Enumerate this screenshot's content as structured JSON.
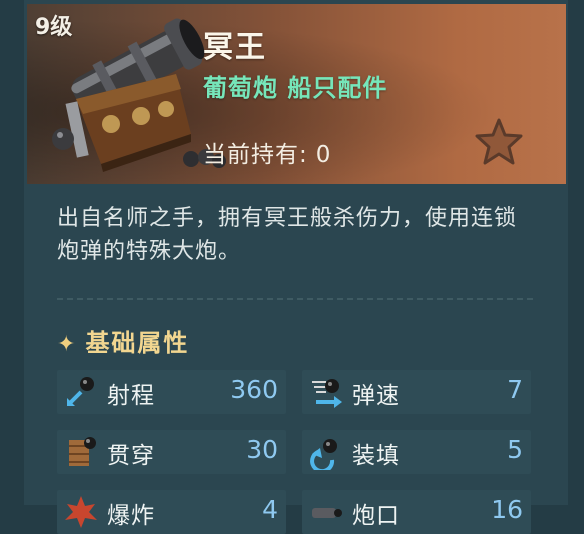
{
  "item": {
    "level": "9级",
    "name": "冥王",
    "subtitle": "葡萄炮 船只配件",
    "owned_label": "当前持有:",
    "owned_value": "0",
    "description": "出自名师之手，拥有冥王般杀伤力，使用连锁炮弹的特殊大炮。"
  },
  "stats_section": {
    "title": "基础属性",
    "stats": [
      {
        "label": "射程",
        "value": "360",
        "icon": "range-icon"
      },
      {
        "label": "弹速",
        "value": "7",
        "icon": "bullet-speed-icon"
      },
      {
        "label": "贯穿",
        "value": "30",
        "icon": "penetration-icon"
      },
      {
        "label": "装填",
        "value": "5",
        "icon": "reload-icon"
      },
      {
        "label": "爆炸",
        "value": "4",
        "icon": "explosion-icon"
      },
      {
        "label": "炮口",
        "value": "16",
        "icon": "muzzle-icon"
      }
    ]
  },
  "colors": {
    "accent_green": "#76e6ba",
    "value_blue": "#8fc9f0",
    "section_gold": "#f2d690"
  }
}
